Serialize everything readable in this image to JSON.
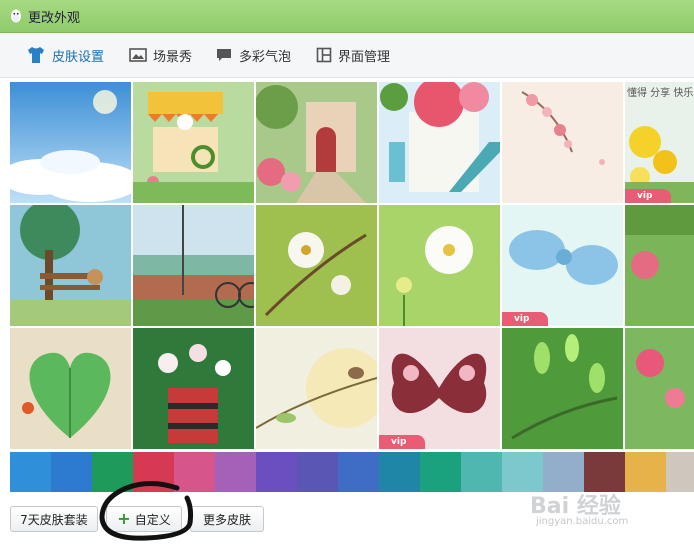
{
  "window": {
    "title": "更改外观"
  },
  "tabs": [
    {
      "label": "皮肤设置",
      "icon": "tshirt-icon",
      "active": true
    },
    {
      "label": "场景秀",
      "icon": "picture-icon"
    },
    {
      "label": "多彩气泡",
      "icon": "speech-bubble-icon"
    },
    {
      "label": "界面管理",
      "icon": "layout-icon"
    }
  ],
  "skins": [
    {
      "scene": "sky-clouds"
    },
    {
      "scene": "flower-cart"
    },
    {
      "scene": "garden-path"
    },
    {
      "scene": "white-stairs"
    },
    {
      "scene": "pink-blossom"
    },
    {
      "scene": "happy-yellow-flowers",
      "vip": "vip",
      "text": "懂得 分享 快乐"
    },
    {
      "scene": "park-bench"
    },
    {
      "scene": "bicycle"
    },
    {
      "scene": "plum-blossom"
    },
    {
      "scene": "white-flower"
    },
    {
      "scene": "gingham-bow",
      "vip": "vip"
    },
    {
      "scene": "green-garden"
    },
    {
      "scene": "heart-leaf"
    },
    {
      "scene": "cup-flowers"
    },
    {
      "scene": "bird-branch"
    },
    {
      "scene": "butterfly",
      "vip": "vip"
    },
    {
      "scene": "green-sprouts"
    },
    {
      "scene": "pink-flowers"
    }
  ],
  "swatch_colors": [
    "#2f8fd8",
    "#2c7bd0",
    "#1e9b5a",
    "#d63a52",
    "#d6568c",
    "#a560b8",
    "#6a4fc0",
    "#5a57b4",
    "#3f6cc4",
    "#1f86a8",
    "#1aa17d",
    "#4fb6b0",
    "#7dc8cc",
    "#92aecb",
    "#7a3a3c",
    "#e8b24a",
    "#cfc6bd"
  ],
  "buttons": {
    "seven_day": "7天皮肤套装",
    "custom": "自定义",
    "custom_icon": "plus-icon",
    "more": "更多皮肤"
  },
  "watermark": {
    "brand": "Bai 经验",
    "url": "jingyan.baidu.com"
  },
  "colors": {
    "titlebar": "#98d174",
    "active_tab": "#1d6fb0"
  }
}
